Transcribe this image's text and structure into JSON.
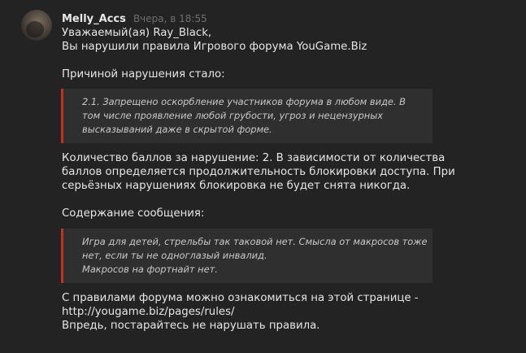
{
  "header": {
    "username": "Melly_Accs",
    "timestamp": "Вчера, в 18:55"
  },
  "message": {
    "greeting": "Уважаемый(ая) Ray_Black,",
    "violation_notice": "Вы нарушили правила Игрового форума YouGame.Biz",
    "reason_heading": "Причиной нарушения стало:",
    "rule_quote": [
      "2.1. Запрещено оскорбление участников форума в любом виде. В",
      "том числе проявление любой грубости, угроз и нецензурных",
      "высказываний даже в скрытой форме."
    ],
    "points_text": [
      "Количество баллов за нарушение: 2. В зависимости от количества",
      "баллов определяется продолжительность блокировки доступа. При",
      "серьёзных нарушениях блокировка не будет снята никогда."
    ],
    "content_heading": "Содержание сообщения:",
    "content_quote": [
      "Игра для детей, стрельбы так таковой нет. Смысла от макросов тоже",
      "нет, если ты не одноглазый инвалид.",
      "Макросов на фортнайт нет."
    ],
    "rules_intro": "С правилами форума можно ознакомиться на этой странице -",
    "rules_link": "http://yougame.biz/pages/rules/",
    "closing": "Впредь, постарайтесь не нарушать правила."
  },
  "colors": {
    "background": "#232323",
    "quote_background": "#2f2f2f",
    "quote_border": "#c2331f",
    "text": "#e6e6e6",
    "muted": "#6f6f6f"
  }
}
